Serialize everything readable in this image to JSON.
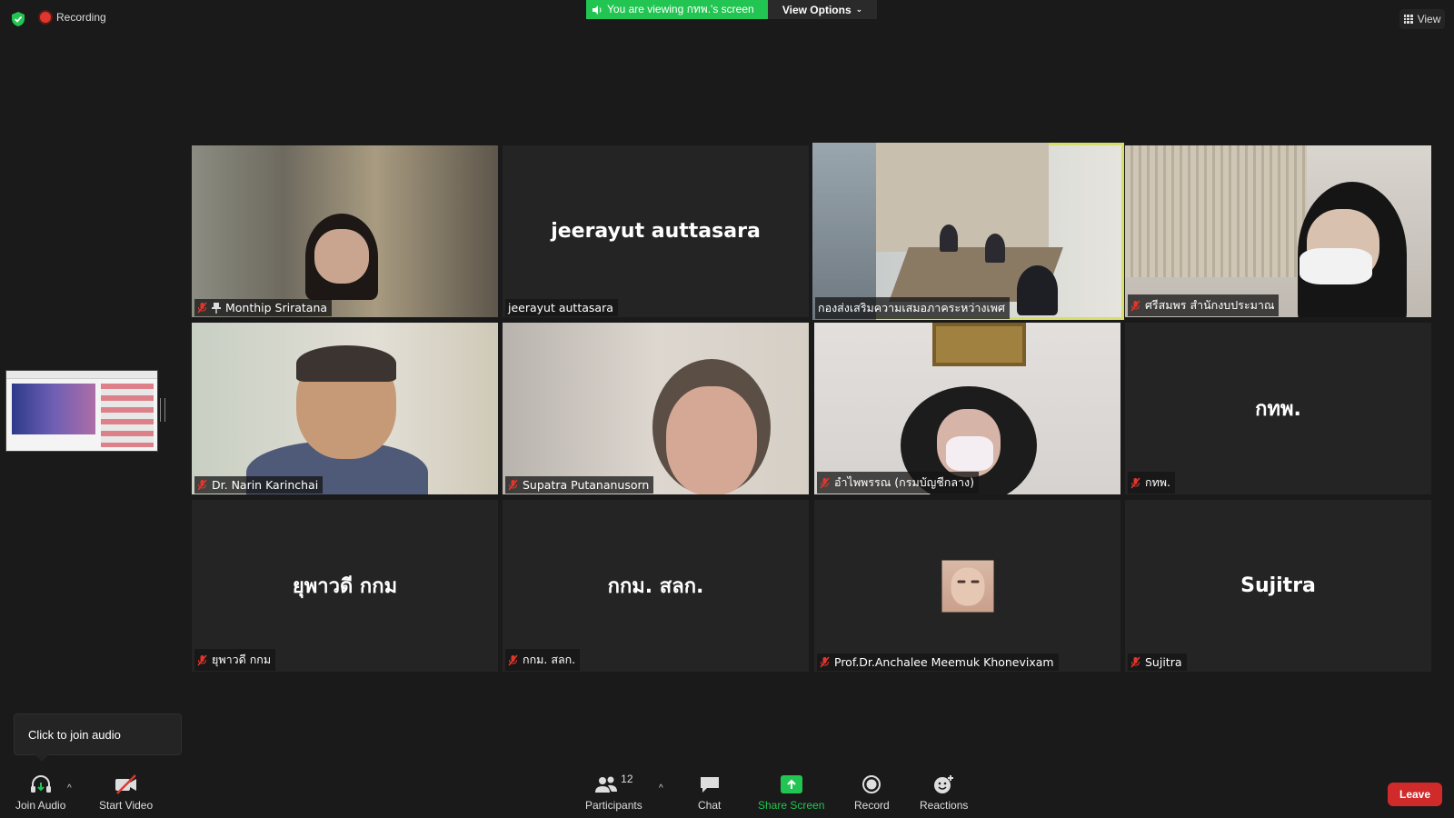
{
  "top_bar": {
    "recording_label": "Recording",
    "banner_text": "You are viewing กทพ.'s screen",
    "view_options_label": "View Options",
    "view_label": "View"
  },
  "participants_tiles": [
    {
      "display_name": "",
      "label": "Monthip Sriratana",
      "muted": true,
      "pinned": true,
      "video": true
    },
    {
      "display_name": "jeerayut auttasara",
      "label": "jeerayut auttasara",
      "muted": false,
      "video": false
    },
    {
      "display_name": "",
      "label": "กองส่งเสริมความเสมอภาคระหว่างเพศ",
      "muted": false,
      "video": true,
      "active_speaker": true
    },
    {
      "display_name": "",
      "label": "ศรีสมพร สำนักงบประมาณ",
      "muted": true,
      "video": true
    },
    {
      "display_name": "",
      "label": "Dr. Narin Karinchai",
      "muted": true,
      "video": true
    },
    {
      "display_name": "",
      "label": "Supatra Putananusorn",
      "muted": true,
      "video": true
    },
    {
      "display_name": "",
      "label": "อำไพพรรณ (กรมบัญชีกลาง)",
      "muted": true,
      "video": true
    },
    {
      "display_name": "กทพ.",
      "label": "กทพ.",
      "muted": true,
      "video": false
    },
    {
      "display_name": "ยุพาวดี กกม",
      "label": "ยุพาวดี กกม",
      "muted": true,
      "video": false
    },
    {
      "display_name": "กกม. สลก.",
      "label": "กกม. สลก.",
      "muted": true,
      "video": false
    },
    {
      "display_name": "",
      "label": "Prof.Dr.Anchalee Meemuk Khonevixam",
      "muted": true,
      "video": false,
      "avatar": true
    },
    {
      "display_name": "Sujitra",
      "label": "Sujitra",
      "muted": true,
      "video": false
    }
  ],
  "tooltip": {
    "text": "Click to join audio"
  },
  "toolbar": {
    "join_audio": "Join Audio",
    "start_video": "Start Video",
    "participants": "Participants",
    "participants_count": "12",
    "chat": "Chat",
    "share_screen": "Share Screen",
    "record": "Record",
    "reactions": "Reactions",
    "leave": "Leave"
  },
  "colors": {
    "accent_green": "#23c552",
    "leave_red": "#d12a2a",
    "active_speaker": "#d8de6a"
  }
}
